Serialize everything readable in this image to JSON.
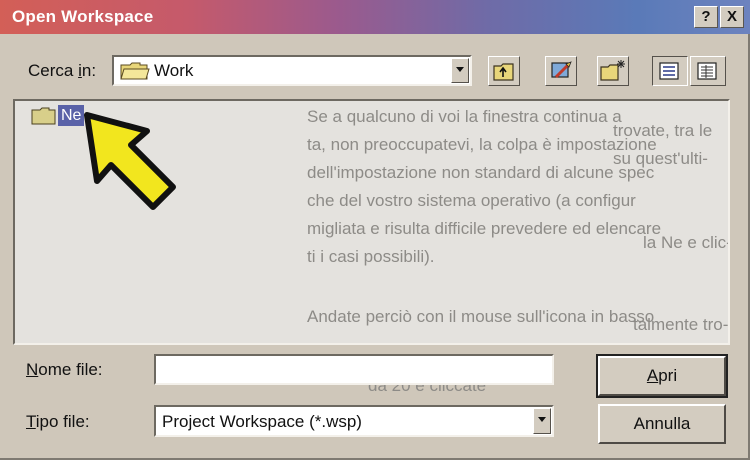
{
  "window": {
    "title": "Open Workspace"
  },
  "titlebar_buttons": {
    "help": "?",
    "close": "X"
  },
  "look_in": {
    "label_prefix": "Cerca ",
    "label_key": "i",
    "label_suffix": "n:",
    "value": "Work"
  },
  "toolbar": {
    "up_icon": "up-folder-icon",
    "desktop_icon": "desktop-icon",
    "new_folder_icon": "new-folder-icon",
    "list_view_icon": "list-view-icon",
    "details_view_icon": "details-view-icon"
  },
  "file_list": {
    "items": [
      {
        "name": "Ne",
        "icon": "folder-icon",
        "selected": true
      }
    ]
  },
  "background_text": [
    "Se a qualcuno di voi la finestra continua a",
    "ta, non preoccupatevi, la colpa è impostazione",
    "dell'impostazione non standard di alcune spec",
    "che del vostro sistema operativo (a configur",
    "migliata e risulta difficile prevedere ed elencare",
    "ti i casi possibili).",
    "Andate perciò con il mouse sull'icona in basso",
    "da 20 e cliccate",
    "trovate, tra le",
    "su quest'ulti-",
    "la Ne e clic-",
    "talmente tro-"
  ],
  "filename": {
    "label_key": "N",
    "label_rest": "ome file:",
    "value": ""
  },
  "filetype": {
    "label_key": "T",
    "label_rest": "ipo file:",
    "value": "Project Workspace (*.wsp)"
  },
  "buttons": {
    "open_key": "A",
    "open_rest": "pri",
    "cancel": "Annulla"
  },
  "colors": {
    "arrow": "#f2e61e",
    "selection": "#5a62a8"
  }
}
